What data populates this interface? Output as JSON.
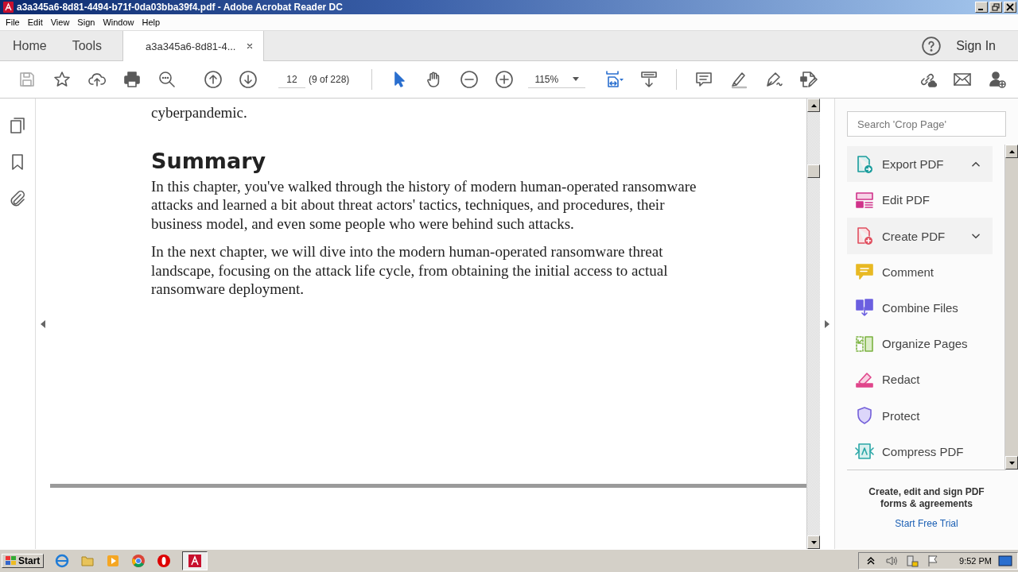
{
  "window": {
    "title": "a3a345a6-8d81-4494-b71f-0da03bba39f4.pdf - Adobe Acrobat Reader DC"
  },
  "menu": [
    "File",
    "Edit",
    "View",
    "Sign",
    "Window",
    "Help"
  ],
  "tabs": [
    {
      "label": "Home",
      "selected": false,
      "kind": "nav"
    },
    {
      "label": "Tools",
      "selected": false,
      "kind": "nav"
    },
    {
      "label": "a3a345a6-8d81-4...",
      "selected": true,
      "kind": "document"
    }
  ],
  "account": {
    "sign_in": "Sign In"
  },
  "toolbar": {
    "page_number": "12",
    "page_count": "(9 of 228)",
    "zoom": "115%"
  },
  "document": {
    "lines": [
      {
        "kind": "body",
        "text": "cyberpandemic."
      },
      {
        "kind": "heading",
        "text": "Summary"
      },
      {
        "kind": "body",
        "text": "In this chapter, you've walked through the history of modern human-operated ransomware attacks and learned a bit about threat actors' tactics, techniques, and procedures, their business model, and even some people who were behind such attacks."
      },
      {
        "kind": "body",
        "text": "In the next chapter, we will dive into the modern human-operated ransomware threat landscape, focusing on the attack life cycle, from obtaining the initial access to actual ransomware deployment."
      }
    ]
  },
  "tools_panel": {
    "search": {
      "placeholder": "Search 'Crop Page'"
    },
    "tools": [
      {
        "label": "Export PDF",
        "kind": "group",
        "expanded": true
      },
      {
        "label": "Edit PDF",
        "kind": "tool"
      },
      {
        "label": "Create PDF",
        "kind": "group",
        "expanded": false
      },
      {
        "label": "Comment",
        "kind": "tool"
      },
      {
        "label": "Combine Files",
        "kind": "tool"
      },
      {
        "label": "Organize Pages",
        "kind": "tool"
      },
      {
        "label": "Redact",
        "kind": "tool"
      },
      {
        "label": "Protect",
        "kind": "tool"
      },
      {
        "label": "Compress PDF",
        "kind": "tool"
      }
    ],
    "promo": {
      "text": "Create, edit and sign PDF forms & agreements",
      "link": "Start Free Trial"
    }
  },
  "taskbar": {
    "start": "Start",
    "clock": "9:52 PM"
  }
}
